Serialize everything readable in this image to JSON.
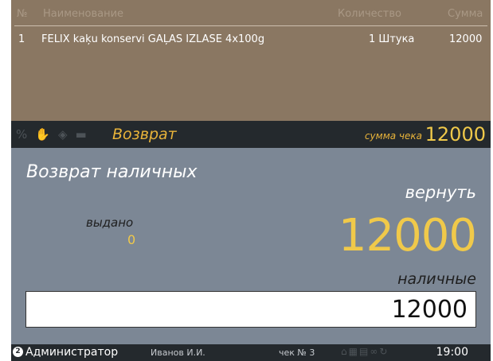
{
  "receipt": {
    "columns": {
      "no": "№",
      "name": "Наименование",
      "qty": "Количество",
      "sum": "Сумма"
    },
    "rows": [
      {
        "no": "1",
        "name": "FELIX kaķu konservi GAĻAS IZLASE 4x100g",
        "qty": "1 Штука",
        "sum": "12000"
      }
    ]
  },
  "modebar": {
    "icons": [
      "percent-icon",
      "hand-icon",
      "tag-icon",
      "card-icon"
    ],
    "mode_title": "Возврат",
    "sum_label": "сумма чека",
    "sum_value": "12000",
    "accent": "#e8b33a"
  },
  "main": {
    "title": "Возврат наличных",
    "return_label": "вернуть",
    "issued_label": "выдано",
    "issued_value": "0",
    "amount": "12000",
    "cash_label": "наличные",
    "input_value": "12000"
  },
  "status": {
    "user_badge": "2",
    "user": "Администратор",
    "person": "Иванов И.И.",
    "check": "чек № 3",
    "icons": [
      "lock-icon",
      "grid-icon",
      "doc-icon",
      "link-icon",
      "refresh-icon"
    ],
    "time": "19:00"
  }
}
